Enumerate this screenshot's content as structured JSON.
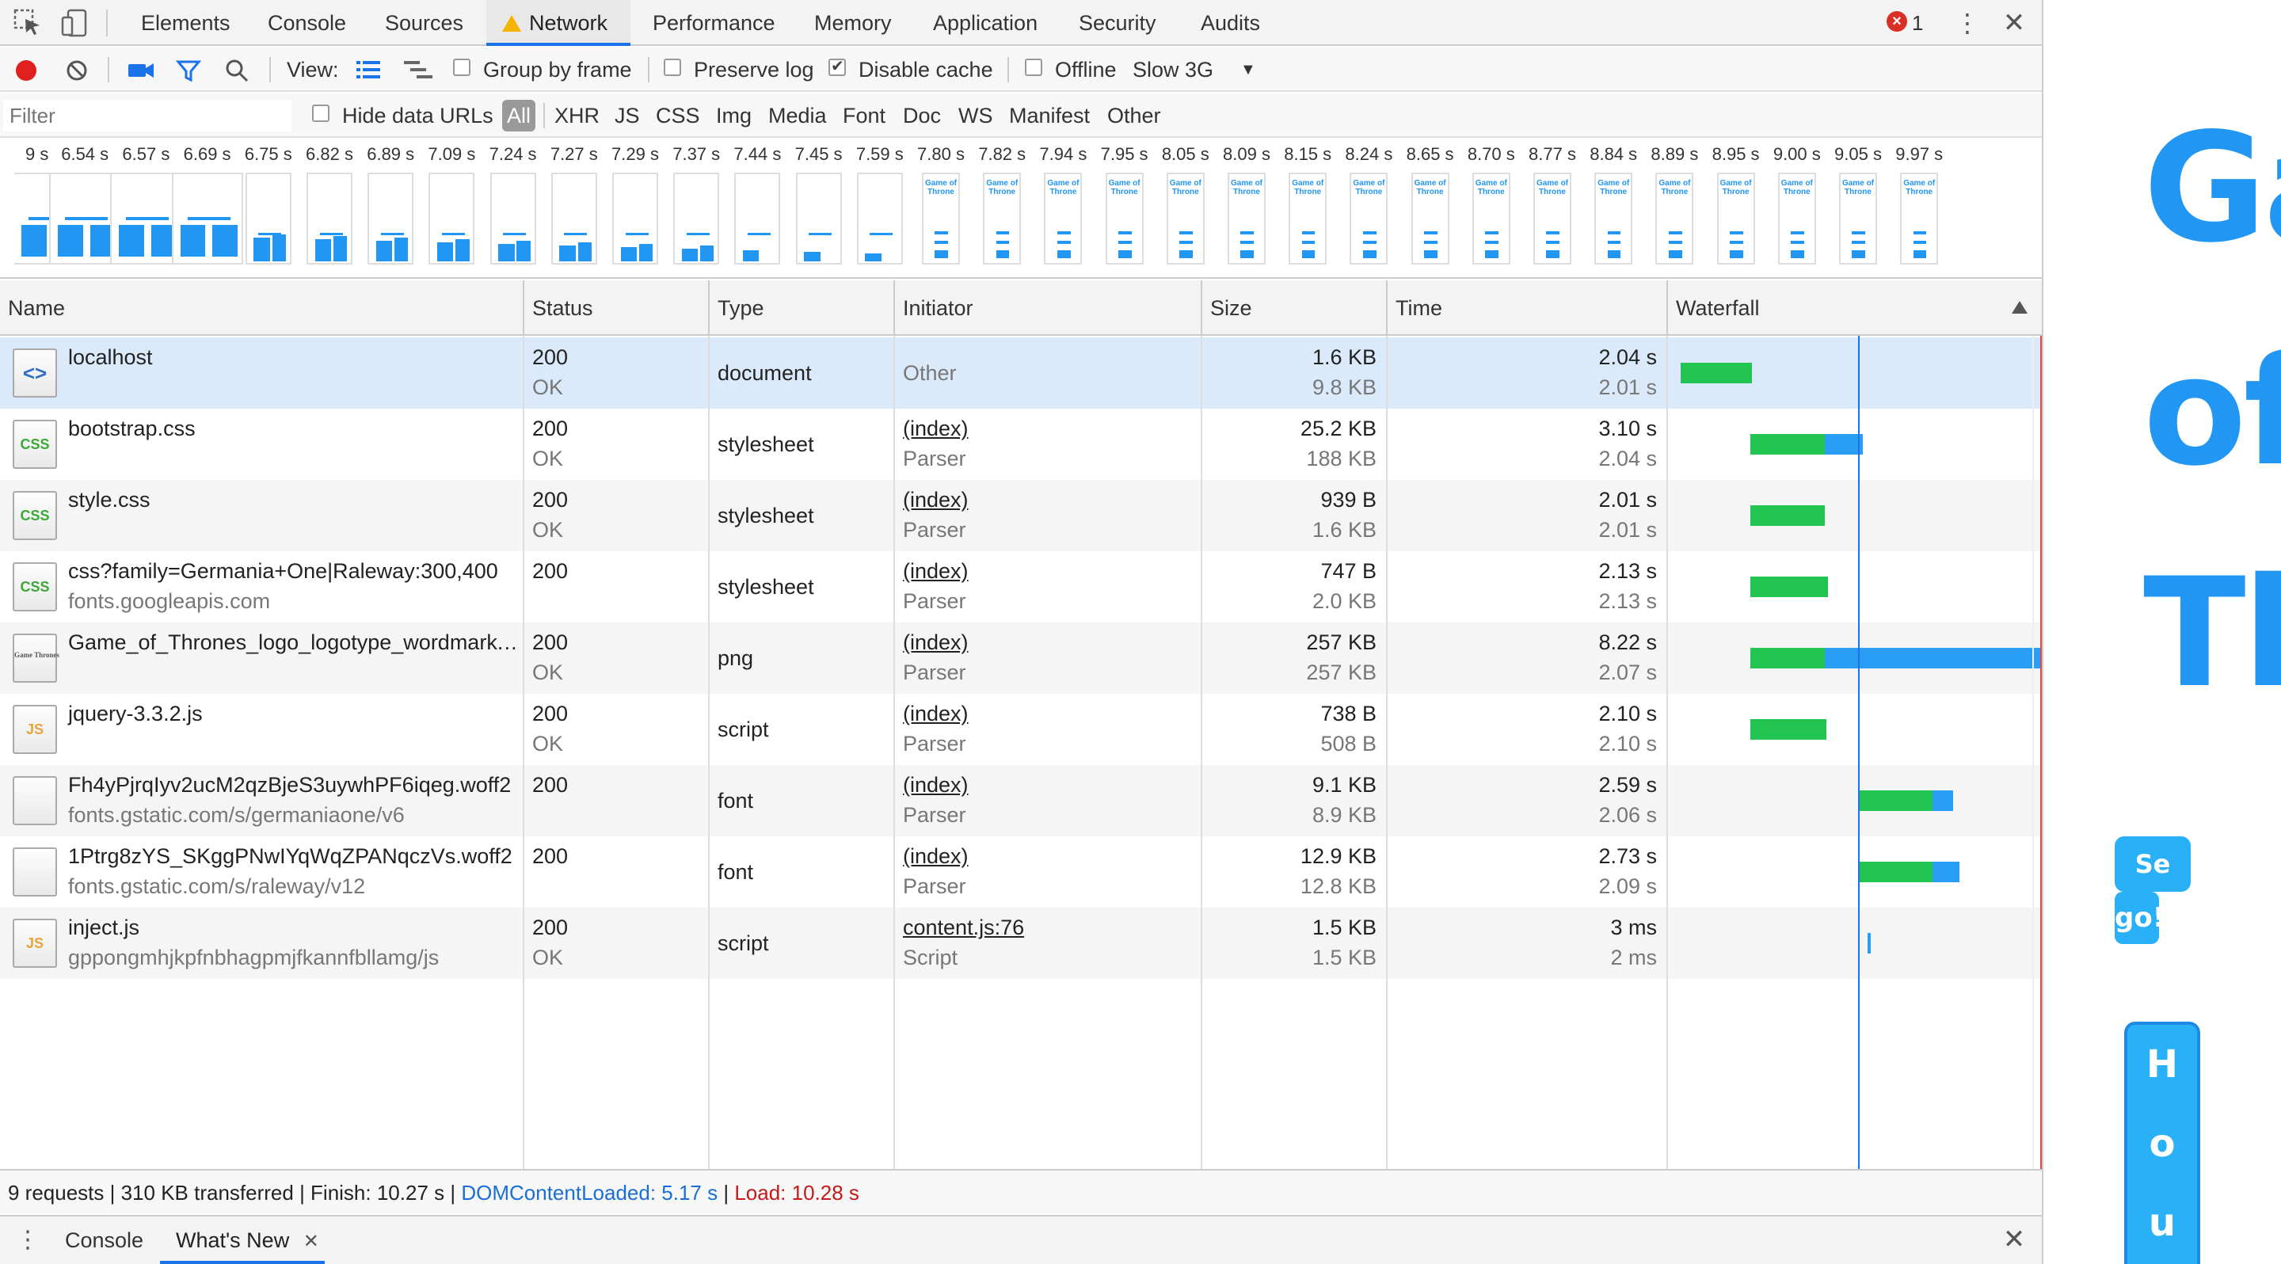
{
  "tabs": {
    "items": [
      "Elements",
      "Console",
      "Sources",
      "Network",
      "Performance",
      "Memory",
      "Application",
      "Security",
      "Audits"
    ],
    "active": "Network",
    "error_count": "1"
  },
  "toolbar": {
    "view_label": "View:",
    "group_by_frame": "Group by frame",
    "preserve_log": "Preserve log",
    "disable_cache": "Disable cache",
    "offline": "Offline",
    "throttle": "Slow 3G",
    "group_by_frame_checked": false,
    "preserve_log_checked": false,
    "disable_cache_checked": true,
    "offline_checked": false
  },
  "filter": {
    "placeholder": "Filter",
    "hide_data_urls": "Hide data URLs",
    "types": [
      "All",
      "XHR",
      "JS",
      "CSS",
      "Img",
      "Media",
      "Font",
      "Doc",
      "WS",
      "Manifest",
      "Other"
    ],
    "active_type": "All"
  },
  "filmstrip": {
    "times": [
      "9 s",
      "6.54 s",
      "6.57 s",
      "6.69 s",
      "6.75 s",
      "6.82 s",
      "6.89 s",
      "7.09 s",
      "7.24 s",
      "7.27 s",
      "7.29 s",
      "7.37 s",
      "7.44 s",
      "7.45 s",
      "7.59 s",
      "7.80 s",
      "7.82 s",
      "7.94 s",
      "7.95 s",
      "8.05 s",
      "8.09 s",
      "8.15 s",
      "8.24 s",
      "8.65 s",
      "8.70 s",
      "8.77 s",
      "8.84 s",
      "8.89 s",
      "8.95 s",
      "9.00 s",
      "9.05 s",
      "9.97 s"
    ],
    "thumb_text": "Game of Throne"
  },
  "table": {
    "columns": [
      "Name",
      "Status",
      "Type",
      "Initiator",
      "Size",
      "Time",
      "Waterfall"
    ],
    "rows": [
      {
        "name": "localhost",
        "domain": "",
        "status": "200",
        "status_text": "OK",
        "type": "document",
        "initiator": "Other",
        "initiator_sub": "",
        "size": "1.6 KB",
        "size_sub": "9.8 KB",
        "time": "2.04 s",
        "time_sub": "2.01 s",
        "icon": "html-icon",
        "icon_text": "<>"
      },
      {
        "name": "bootstrap.css",
        "domain": "",
        "status": "200",
        "status_text": "OK",
        "type": "stylesheet",
        "initiator": "(index)",
        "initiator_sub": "Parser",
        "size": "25.2 KB",
        "size_sub": "188 KB",
        "time": "3.10 s",
        "time_sub": "2.04 s",
        "icon": "css-icon",
        "icon_text": "CSS"
      },
      {
        "name": "style.css",
        "domain": "",
        "status": "200",
        "status_text": "OK",
        "type": "stylesheet",
        "initiator": "(index)",
        "initiator_sub": "Parser",
        "size": "939 B",
        "size_sub": "1.6 KB",
        "time": "2.01 s",
        "time_sub": "2.01 s",
        "icon": "css-icon",
        "icon_text": "CSS"
      },
      {
        "name": "css?family=Germania+One|Raleway:300,400",
        "domain": "fonts.googleapis.com",
        "status": "200",
        "status_text": "",
        "type": "stylesheet",
        "initiator": "(index)",
        "initiator_sub": "Parser",
        "size": "747 B",
        "size_sub": "2.0 KB",
        "time": "2.13 s",
        "time_sub": "2.13 s",
        "icon": "css-icon",
        "icon_text": "CSS"
      },
      {
        "name": "Game_of_Thrones_logo_logotype_wordmark.…",
        "domain": "",
        "status": "200",
        "status_text": "OK",
        "type": "png",
        "initiator": "(index)",
        "initiator_sub": "Parser",
        "size": "257 KB",
        "size_sub": "257 KB",
        "time": "8.22 s",
        "time_sub": "2.07 s",
        "icon": "image-icon",
        "icon_text": "Game Thrones"
      },
      {
        "name": "jquery-3.3.2.js",
        "domain": "",
        "status": "200",
        "status_text": "OK",
        "type": "script",
        "initiator": "(index)",
        "initiator_sub": "Parser",
        "size": "738 B",
        "size_sub": "508 B",
        "time": "2.10 s",
        "time_sub": "2.10 s",
        "icon": "js-icon",
        "icon_text": "JS"
      },
      {
        "name": "Fh4yPjrqIyv2ucM2qzBjeS3uywhPF6iqeg.woff2",
        "domain": "fonts.gstatic.com/s/germaniaone/v6",
        "status": "200",
        "status_text": "",
        "type": "font",
        "initiator": "(index)",
        "initiator_sub": "Parser",
        "size": "9.1 KB",
        "size_sub": "8.9 KB",
        "time": "2.59 s",
        "time_sub": "2.06 s",
        "icon": "font-file-icon",
        "icon_text": ""
      },
      {
        "name": "1Ptrg8zYS_SKggPNwIYqWqZPANqczVs.woff2",
        "domain": "fonts.gstatic.com/s/raleway/v12",
        "status": "200",
        "status_text": "",
        "type": "font",
        "initiator": "(index)",
        "initiator_sub": "Parser",
        "size": "12.9 KB",
        "size_sub": "12.8 KB",
        "time": "2.73 s",
        "time_sub": "2.09 s",
        "icon": "font-file-icon",
        "icon_text": ""
      },
      {
        "name": "inject.js",
        "domain": "gppongmhjkpfnbhagpmjfkannfbllamg/js",
        "status": "200",
        "status_text": "OK",
        "type": "script",
        "initiator": "content.js:76",
        "initiator_sub": "Script",
        "size": "1.5 KB",
        "size_sub": "1.5 KB",
        "time": "3 ms",
        "time_sub": "2 ms",
        "icon": "js-icon",
        "icon_text": "JS"
      }
    ]
  },
  "status_bar": {
    "summary": "9 requests | 310 KB transferred | Finish: 10.27 s |",
    "dom_content_loaded": "DOMContentLoaded: 5.17 s",
    "sep": "|",
    "load": "Load: 10.28 s"
  },
  "drawer": {
    "tabs": [
      "Console",
      "What's New"
    ],
    "active": "What's New"
  },
  "preview": {
    "words": [
      "Ga",
      "of",
      "Th"
    ],
    "button_top": "Se",
    "button_bottom": "go!",
    "side_letters": [
      "H",
      "o",
      "u"
    ]
  },
  "colors": {
    "accent": "#1a73e8",
    "waterfall_waiting": "#23c552",
    "waterfall_download": "#2a9df4",
    "load_line": "#e04848",
    "page_title": "#2196f3"
  }
}
